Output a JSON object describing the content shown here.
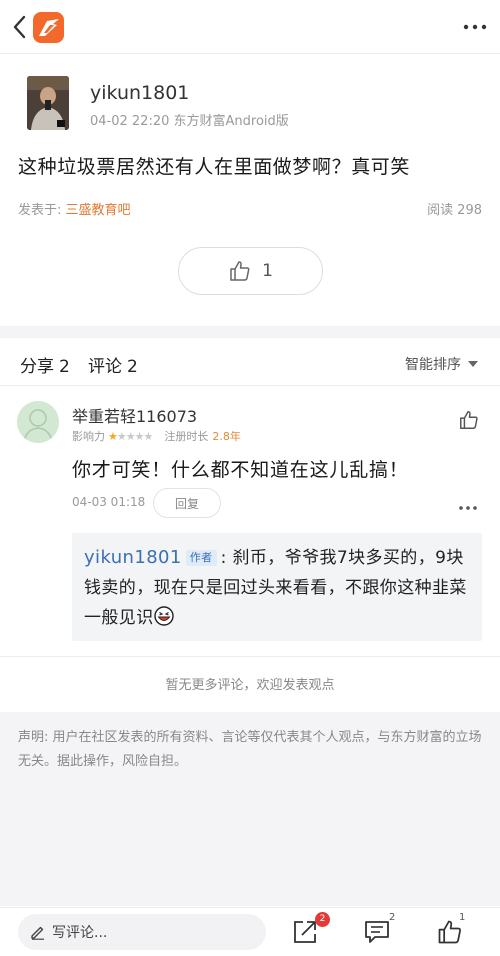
{
  "post": {
    "author": "yikun1801",
    "meta": "04-02 22:20 东方财富Android版",
    "text": "这种垃圾票居然还有人在里面做梦啊？真可笑",
    "from_label": "发表于:",
    "bar_name": "三盛教育吧",
    "read_label": "阅读",
    "read_count": "298",
    "like_count": "1"
  },
  "tabs": {
    "share_label": "分享",
    "share_count": "2",
    "comment_label": "评论",
    "comment_count": "2",
    "sort_label": "智能排序"
  },
  "comment": {
    "user": "举重若轻116073",
    "influence_label": "影响力",
    "stars_filled": 1,
    "stars_total": 5,
    "reg_label": "注册时长",
    "reg_value": "2.8年",
    "text": "你才可笑！什么都不知道在这儿乱搞！",
    "time": "04-03 01:18",
    "reply_label": "回复",
    "reply": {
      "user": "yikun1801",
      "badge": "作者",
      "text": ": 刹币，爷爷我7块多买的，9块钱卖的，现在只是回过头来看看，不跟你这种韭菜一般见识"
    }
  },
  "no_more": "暂无更多评论，欢迎发表观点",
  "disclaimer": "声明: 用户在社区发表的所有资料、言论等仅代表其个人观点，与东方财富的立场无关。据此操作，风险自担。",
  "bottom": {
    "write_placeholder": "写评论...",
    "share_badge": "2",
    "comment_count": "2",
    "like_count": "1"
  },
  "colors": {
    "brand": "#f2692b",
    "link_orange": "#e57a30",
    "author_blue": "#3b6fb6",
    "badge_red": "#e53935",
    "star": "#f5a623"
  },
  "icons": [
    "back-icon",
    "app-logo-icon",
    "more-icon",
    "thumb-up-icon",
    "share-icon",
    "comment-icon",
    "pencil-icon",
    "grinning-emoji-icon"
  ]
}
